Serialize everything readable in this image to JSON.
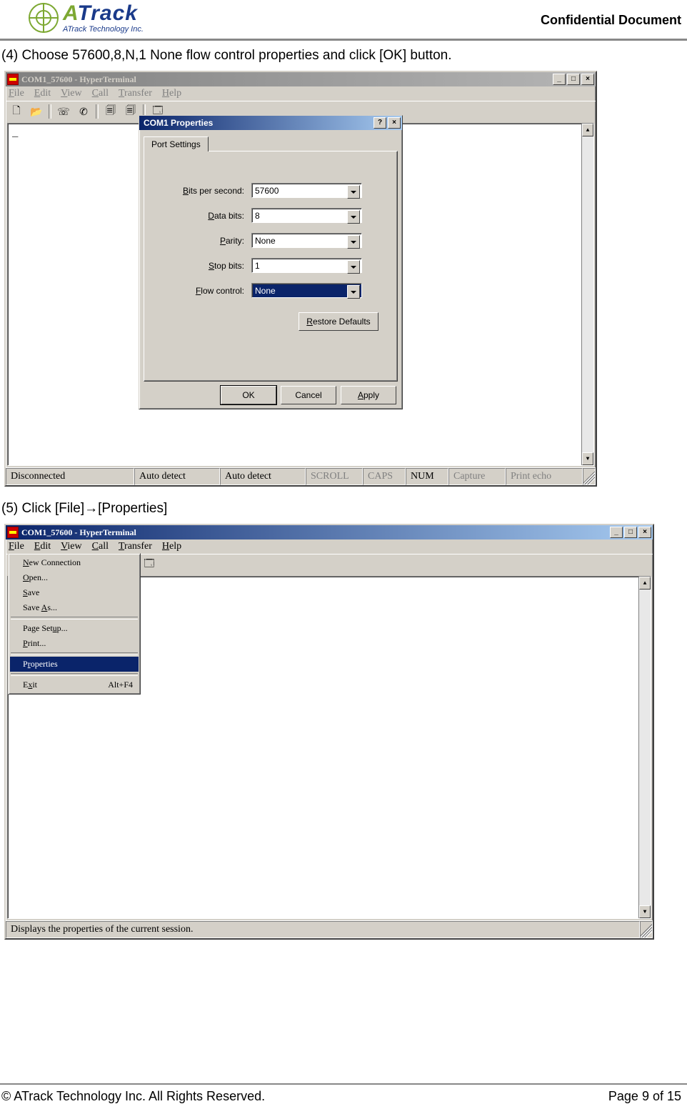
{
  "header": {
    "logo_main_green": "A",
    "logo_main_blue": "Track",
    "logo_sub": "ATrack Technology Inc.",
    "confidential": "Confidential Document"
  },
  "step4": "(4) Choose 57600,8,N,1 None flow control properties and click [OK] button.",
  "step5": "(5) Click [File]→[Properties]",
  "window1": {
    "title": "COM1_57600 - HyperTerminal",
    "menu": {
      "file": "File",
      "edit": "Edit",
      "view": "View",
      "call": "Call",
      "transfer": "Transfer",
      "help": "Help"
    },
    "status": {
      "conn": "Disconnected",
      "auto1": "Auto detect",
      "auto2": "Auto detect",
      "scroll": "SCROLL",
      "caps": "CAPS",
      "num": "NUM",
      "capture": "Capture",
      "printecho": "Print echo"
    }
  },
  "dialog": {
    "title": "COM1   Properties",
    "tab": "Port Settings",
    "labels": {
      "bps": "Bits per second:",
      "data": "Data bits:",
      "parity": "Parity:",
      "stop": "Stop bits:",
      "flow": "Flow control:"
    },
    "values": {
      "bps": "57600",
      "data": "8",
      "parity": "None",
      "stop": "1",
      "flow": "None"
    },
    "restore": "Restore Defaults",
    "ok": "OK",
    "cancel": "Cancel",
    "apply": "Apply"
  },
  "window2": {
    "title": "COM1_57600 - HyperTerminal",
    "menu": {
      "file": "File",
      "edit": "Edit",
      "view": "View",
      "call": "Call",
      "transfer": "Transfer",
      "help": "Help"
    },
    "filemenu": {
      "new": "New Connection",
      "open": "Open...",
      "save": "Save",
      "saveas": "Save As...",
      "pagesetup": "Page Setup...",
      "print": "Print...",
      "properties": "Properties",
      "exit": "Exit",
      "exit_accel": "Alt+F4"
    },
    "status": "Displays the properties of the current session."
  },
  "footer": {
    "left": "© ATrack Technology Inc. All Rights Reserved.",
    "right": "Page 9 of 15"
  }
}
